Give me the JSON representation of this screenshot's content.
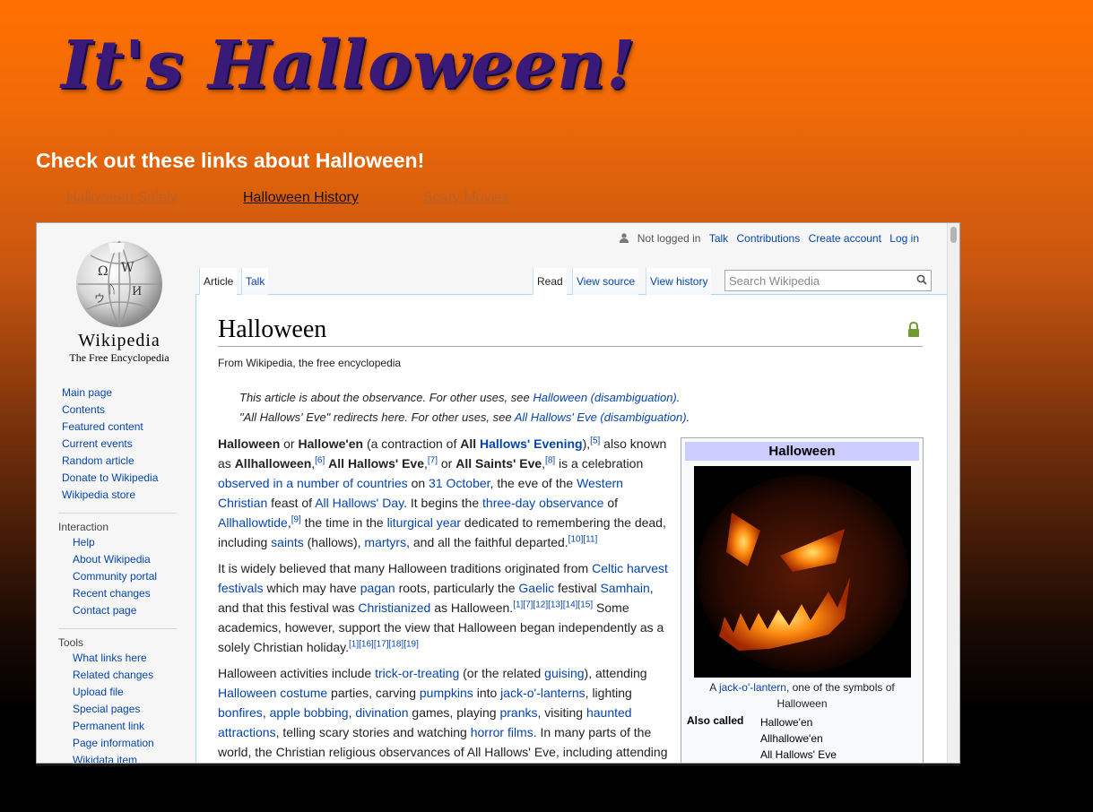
{
  "page": {
    "title": "It's Halloween!",
    "links_heading": "Check out these links about Halloween!",
    "nav_links": [
      "Halloween Safely",
      "Halloween History",
      "Scary Movies"
    ]
  },
  "colors": {
    "title": "#3a1a78",
    "link": "#0645ad",
    "infobox_header": "#ccccff"
  },
  "wiki": {
    "logo_name": "Wikipedia",
    "logo_tagline": "The Free Encyclopedia",
    "personal_tools": {
      "not_logged_in": "Not logged in",
      "talk": "Talk",
      "contributions": "Contributions",
      "create_account": "Create account",
      "log_in": "Log in"
    },
    "tabs": {
      "article": "Article",
      "talk": "Talk",
      "read": "Read",
      "view_source": "View source",
      "view_history": "View history"
    },
    "search": {
      "placeholder": "Search Wikipedia"
    },
    "sidebar": {
      "main": [
        "Main page",
        "Contents",
        "Featured content",
        "Current events",
        "Random article",
        "Donate to Wikipedia",
        "Wikipedia store"
      ],
      "interaction_heading": "Interaction",
      "interaction": [
        "Help",
        "About Wikipedia",
        "Community portal",
        "Recent changes",
        "Contact page"
      ],
      "tools_heading": "Tools",
      "tools": [
        "What links here",
        "Related changes",
        "Upload file",
        "Special pages",
        "Permanent link",
        "Page information",
        "Wikidata item"
      ]
    },
    "article": {
      "title": "Halloween",
      "site_sub": "From Wikipedia, the free encyclopedia",
      "hatnote1_text": "This article is about the observance. For other uses, see ",
      "hatnote1_link": "Halloween (disambiguation)",
      "hatnote1_end": ".",
      "hatnote2_text": "\"All Hallows' Eve\" redirects here. For other uses, see ",
      "hatnote2_link": "All Hallows' Eve (disambiguation)",
      "hatnote2_end": "."
    },
    "infobox": {
      "title": "Halloween",
      "caption_a": "A ",
      "caption_link": "jack-o'-lantern",
      "caption_b": ", one of the symbols of Halloween",
      "also_called_label": "Also called",
      "also_called": [
        "Hallowe'en",
        "Allhallowe'en",
        "All Hallows' Eve"
      ]
    }
  }
}
